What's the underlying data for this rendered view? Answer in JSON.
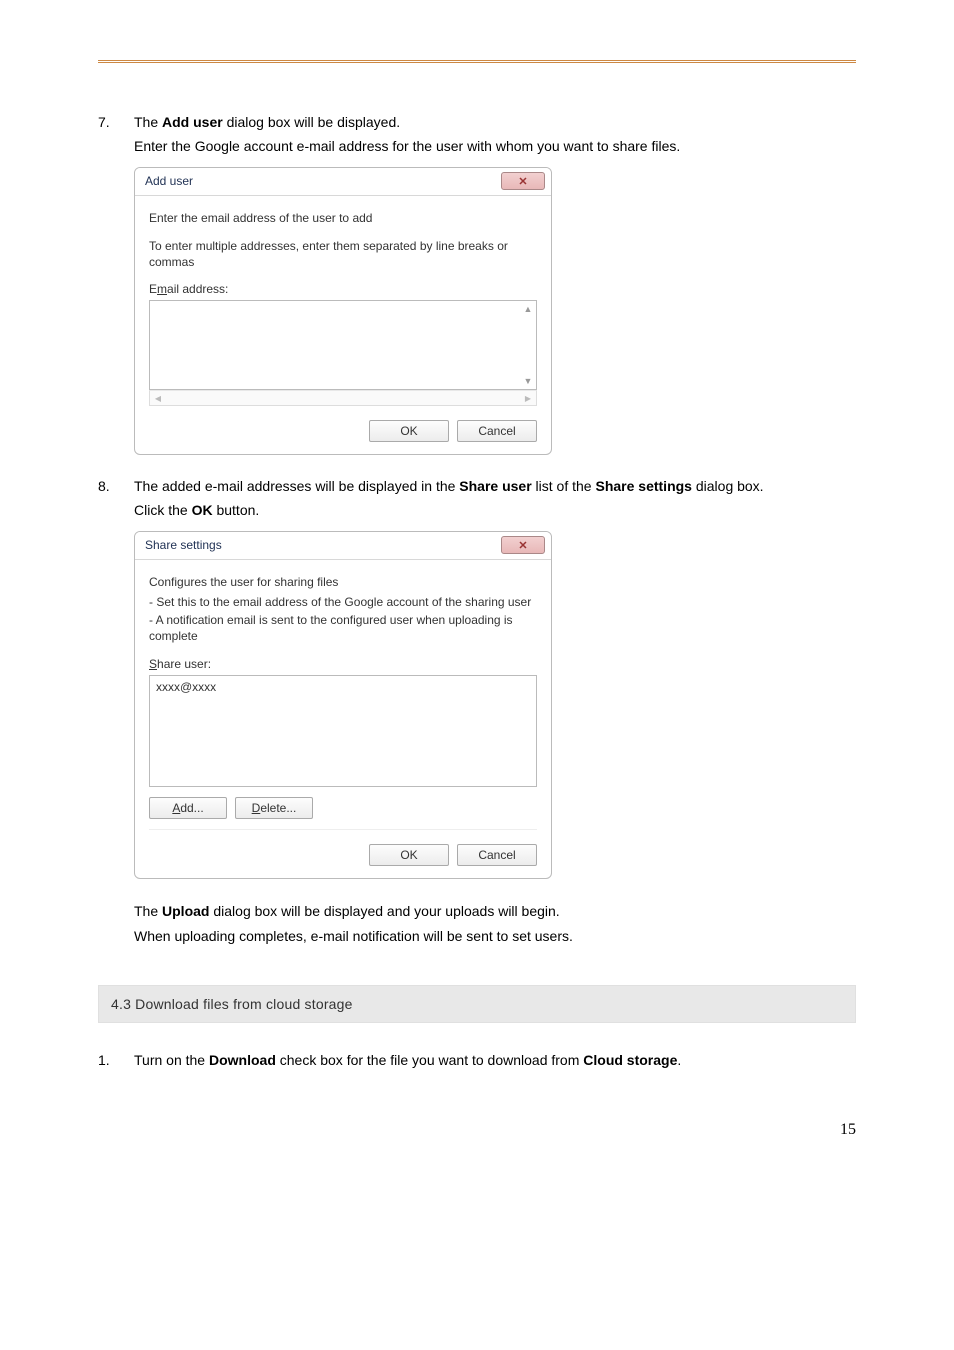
{
  "step7": {
    "num": "7.",
    "line1_a": "The ",
    "line1_b": "Add user",
    "line1_c": " dialog box will be displayed.",
    "line2": "Enter the Google account e-mail address for the user with whom you want to share files."
  },
  "addUserDialog": {
    "title": "Add user",
    "closeGlyph": "✕",
    "para1": "Enter the email address of the user to add",
    "para2": "To enter multiple addresses, enter them separated by line breaks or commas",
    "emailLabel_pre": "E",
    "emailLabel_u": "m",
    "emailLabel_post": "ail address:",
    "ok": "OK",
    "cancel": "Cancel"
  },
  "step8": {
    "num": "8.",
    "line1_a": "The added e-mail addresses will be displayed in the ",
    "line1_b": "Share user",
    "line1_c": " list of the ",
    "line1_d": "Share settings",
    "line1_e": " dialog box.",
    "line2_a": "Click the ",
    "line2_b": "OK",
    "line2_c": " button."
  },
  "shareSettingsDialog": {
    "title": "Share settings",
    "closeGlyph": "✕",
    "line1": "Configures the user for sharing files",
    "line2": " - Set this to the email address of the Google account of the sharing user",
    "line3": " - A notification email is sent to the configured user when uploading is complete",
    "shareUser_pre": "",
    "shareUser_u": "S",
    "shareUser_post": "hare user:",
    "listItem": "xxxx@xxxx",
    "add_u": "A",
    "add_post": "dd...",
    "delete_u": "D",
    "delete_post": "elete...",
    "ok": "OK",
    "cancel": "Cancel"
  },
  "after": {
    "line1_a": "The ",
    "line1_b": "Upload",
    "line1_c": " dialog box will be displayed and your uploads will begin.",
    "line2": "When uploading completes, e-mail notification will be sent to set users."
  },
  "sectionHeading": "4.3 Download files from cloud storage",
  "step1": {
    "num": "1.",
    "a": "Turn on the ",
    "b": "Download",
    "c": " check box for the file you want to download from ",
    "d": "Cloud storage",
    "e": "."
  },
  "pageNumber": "15"
}
